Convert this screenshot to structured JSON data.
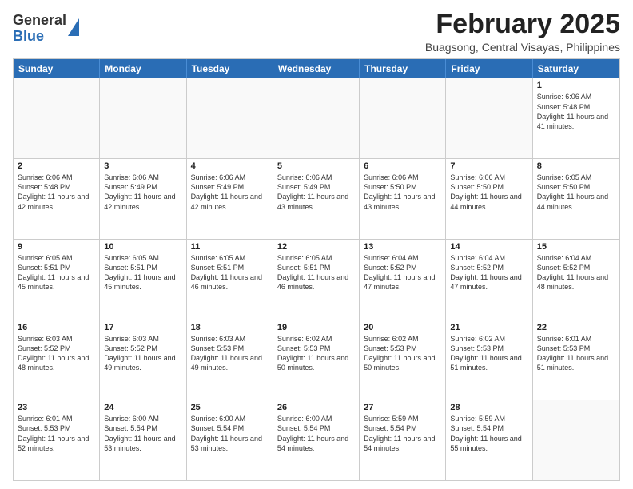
{
  "header": {
    "logo_general": "General",
    "logo_blue": "Blue",
    "month_title": "February 2025",
    "location": "Buagsong, Central Visayas, Philippines"
  },
  "weekdays": [
    "Sunday",
    "Monday",
    "Tuesday",
    "Wednesday",
    "Thursday",
    "Friday",
    "Saturday"
  ],
  "rows": [
    [
      {
        "day": "",
        "info": ""
      },
      {
        "day": "",
        "info": ""
      },
      {
        "day": "",
        "info": ""
      },
      {
        "day": "",
        "info": ""
      },
      {
        "day": "",
        "info": ""
      },
      {
        "day": "",
        "info": ""
      },
      {
        "day": "1",
        "info": "Sunrise: 6:06 AM\nSunset: 5:48 PM\nDaylight: 11 hours and 41 minutes."
      }
    ],
    [
      {
        "day": "2",
        "info": "Sunrise: 6:06 AM\nSunset: 5:48 PM\nDaylight: 11 hours and 42 minutes."
      },
      {
        "day": "3",
        "info": "Sunrise: 6:06 AM\nSunset: 5:49 PM\nDaylight: 11 hours and 42 minutes."
      },
      {
        "day": "4",
        "info": "Sunrise: 6:06 AM\nSunset: 5:49 PM\nDaylight: 11 hours and 42 minutes."
      },
      {
        "day": "5",
        "info": "Sunrise: 6:06 AM\nSunset: 5:49 PM\nDaylight: 11 hours and 43 minutes."
      },
      {
        "day": "6",
        "info": "Sunrise: 6:06 AM\nSunset: 5:50 PM\nDaylight: 11 hours and 43 minutes."
      },
      {
        "day": "7",
        "info": "Sunrise: 6:06 AM\nSunset: 5:50 PM\nDaylight: 11 hours and 44 minutes."
      },
      {
        "day": "8",
        "info": "Sunrise: 6:05 AM\nSunset: 5:50 PM\nDaylight: 11 hours and 44 minutes."
      }
    ],
    [
      {
        "day": "9",
        "info": "Sunrise: 6:05 AM\nSunset: 5:51 PM\nDaylight: 11 hours and 45 minutes."
      },
      {
        "day": "10",
        "info": "Sunrise: 6:05 AM\nSunset: 5:51 PM\nDaylight: 11 hours and 45 minutes."
      },
      {
        "day": "11",
        "info": "Sunrise: 6:05 AM\nSunset: 5:51 PM\nDaylight: 11 hours and 46 minutes."
      },
      {
        "day": "12",
        "info": "Sunrise: 6:05 AM\nSunset: 5:51 PM\nDaylight: 11 hours and 46 minutes."
      },
      {
        "day": "13",
        "info": "Sunrise: 6:04 AM\nSunset: 5:52 PM\nDaylight: 11 hours and 47 minutes."
      },
      {
        "day": "14",
        "info": "Sunrise: 6:04 AM\nSunset: 5:52 PM\nDaylight: 11 hours and 47 minutes."
      },
      {
        "day": "15",
        "info": "Sunrise: 6:04 AM\nSunset: 5:52 PM\nDaylight: 11 hours and 48 minutes."
      }
    ],
    [
      {
        "day": "16",
        "info": "Sunrise: 6:03 AM\nSunset: 5:52 PM\nDaylight: 11 hours and 48 minutes."
      },
      {
        "day": "17",
        "info": "Sunrise: 6:03 AM\nSunset: 5:52 PM\nDaylight: 11 hours and 49 minutes."
      },
      {
        "day": "18",
        "info": "Sunrise: 6:03 AM\nSunset: 5:53 PM\nDaylight: 11 hours and 49 minutes."
      },
      {
        "day": "19",
        "info": "Sunrise: 6:02 AM\nSunset: 5:53 PM\nDaylight: 11 hours and 50 minutes."
      },
      {
        "day": "20",
        "info": "Sunrise: 6:02 AM\nSunset: 5:53 PM\nDaylight: 11 hours and 50 minutes."
      },
      {
        "day": "21",
        "info": "Sunrise: 6:02 AM\nSunset: 5:53 PM\nDaylight: 11 hours and 51 minutes."
      },
      {
        "day": "22",
        "info": "Sunrise: 6:01 AM\nSunset: 5:53 PM\nDaylight: 11 hours and 51 minutes."
      }
    ],
    [
      {
        "day": "23",
        "info": "Sunrise: 6:01 AM\nSunset: 5:53 PM\nDaylight: 11 hours and 52 minutes."
      },
      {
        "day": "24",
        "info": "Sunrise: 6:00 AM\nSunset: 5:54 PM\nDaylight: 11 hours and 53 minutes."
      },
      {
        "day": "25",
        "info": "Sunrise: 6:00 AM\nSunset: 5:54 PM\nDaylight: 11 hours and 53 minutes."
      },
      {
        "day": "26",
        "info": "Sunrise: 6:00 AM\nSunset: 5:54 PM\nDaylight: 11 hours and 54 minutes."
      },
      {
        "day": "27",
        "info": "Sunrise: 5:59 AM\nSunset: 5:54 PM\nDaylight: 11 hours and 54 minutes."
      },
      {
        "day": "28",
        "info": "Sunrise: 5:59 AM\nSunset: 5:54 PM\nDaylight: 11 hours and 55 minutes."
      },
      {
        "day": "",
        "info": ""
      }
    ]
  ]
}
